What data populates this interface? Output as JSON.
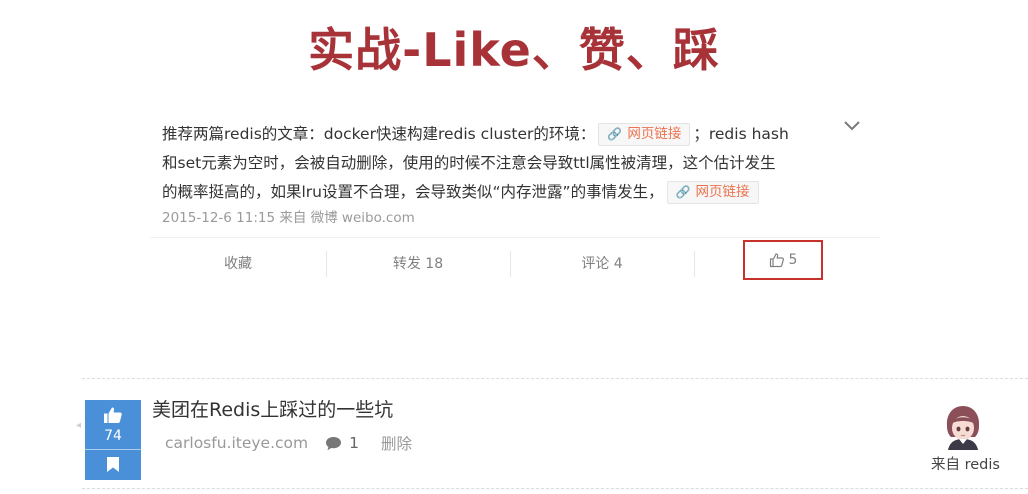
{
  "slide": {
    "title": "实战-Like、赞、踩"
  },
  "weibo_post": {
    "text_line1": "推荐两篇redis的文章：docker快速构建redis cluster的环境：",
    "link_label_1": "网页链接",
    "text_line1_tail": "；redis hash",
    "text_line2": "和set元素为空时，会被自动删除，使用的时候不注意会导致ttl属性被清理，这个估计发生",
    "text_line3": "的概率挺高的，如果lru设置不合理，会导致类似“内存泄露”的事情发生，",
    "link_label_2": "网页链接",
    "meta": "2015-12-6 11:15 来自 微博 weibo.com",
    "actions": {
      "favorite": "收藏",
      "repost": "转发 18",
      "comment": "评论 4",
      "like_count": "5"
    }
  },
  "article": {
    "votes": "74",
    "title": "美团在Redis上踩过的一些坑",
    "source_site": "carlosfu.iteye.com",
    "comment_count": "1",
    "delete_label": "删除",
    "from_label": "来自 redis"
  },
  "icons": [
    "chevron-down-icon",
    "link-icon",
    "thumbs-up-icon",
    "bookmark-icon",
    "comment-icon",
    "avatar"
  ],
  "colors": {
    "title": "#a73238",
    "highlight_box": "#c9322c",
    "vote_bg": "#4a90d9",
    "link_text": "#eb7350"
  }
}
